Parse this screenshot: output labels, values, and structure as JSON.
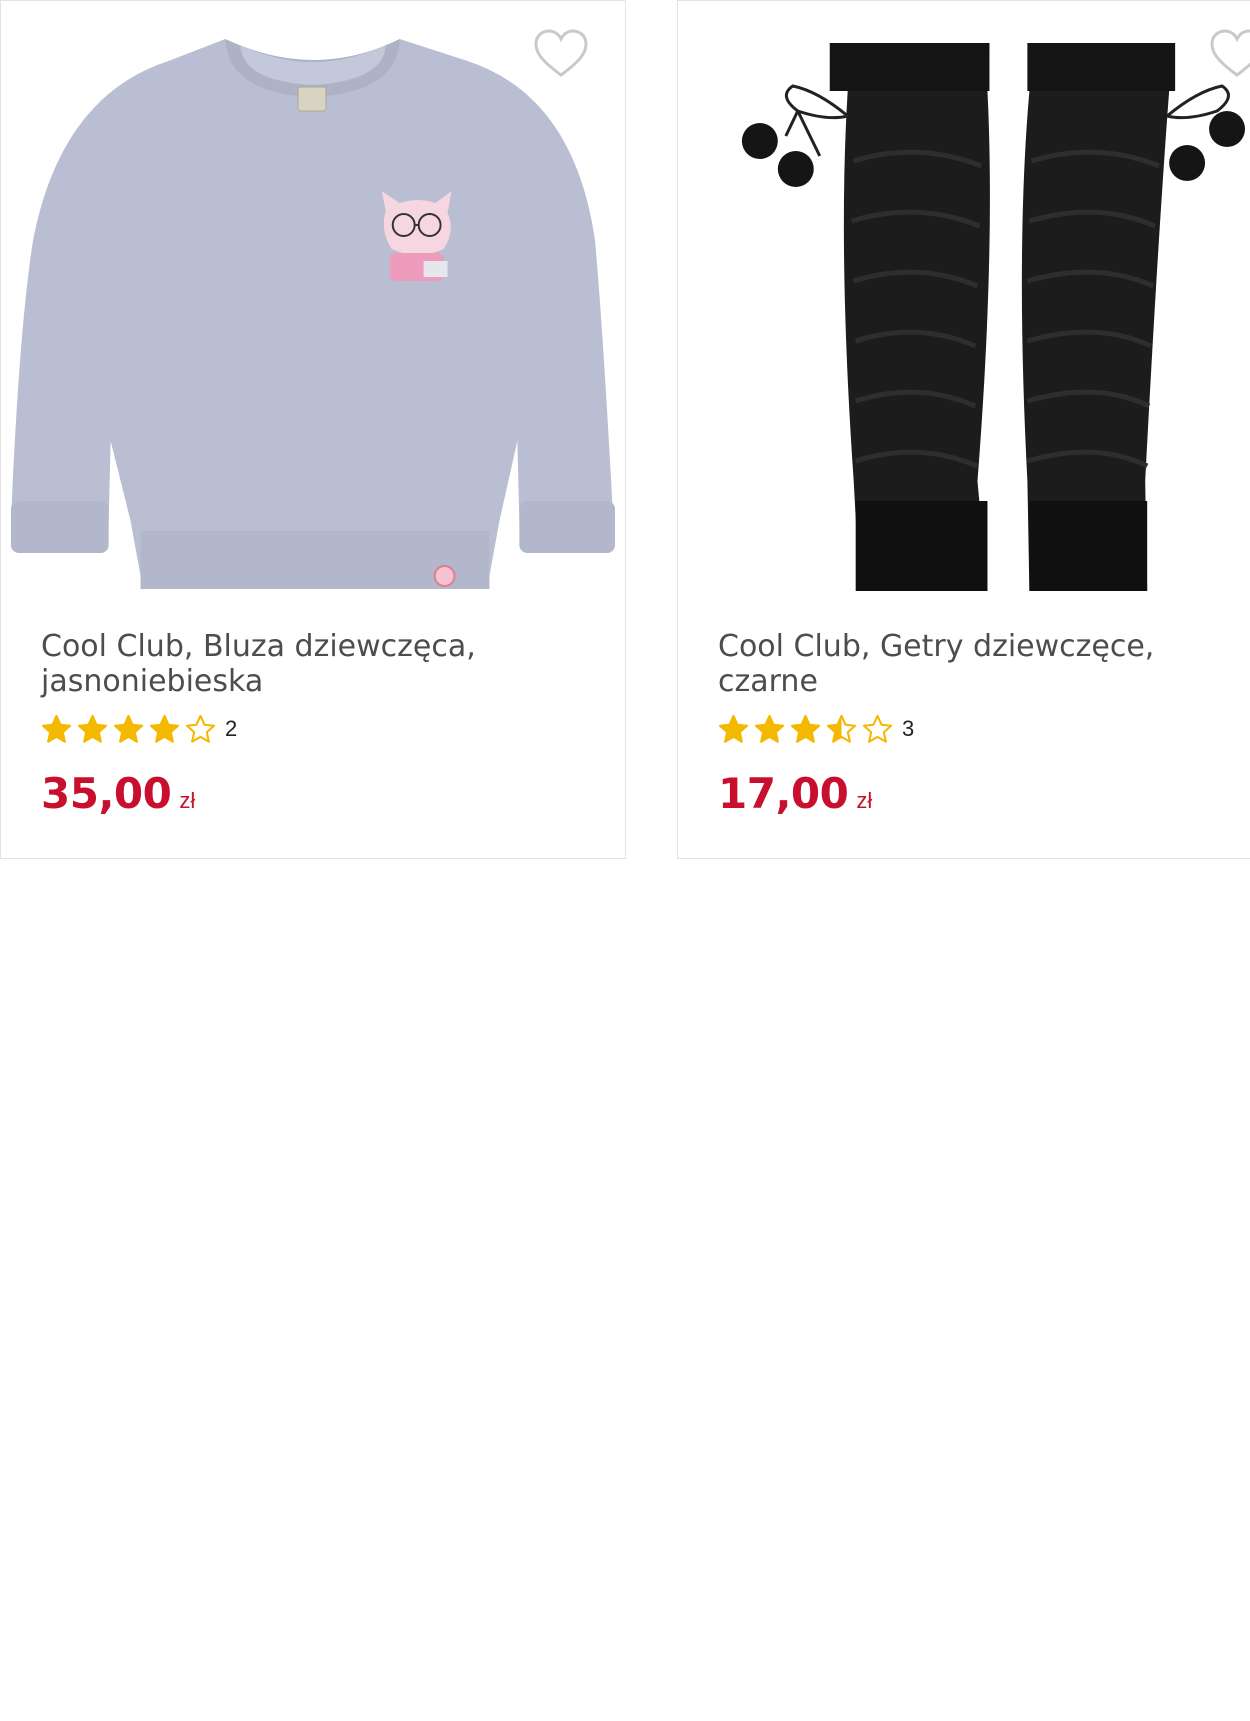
{
  "products": [
    {
      "name": "Cool Club, Bluza dziewczęca, jasnoniebieska",
      "rating": 4,
      "rating_count": "2",
      "price": "35,00",
      "currency": "zł",
      "image": "light-blue-sweatshirt-with-cat-print"
    },
    {
      "name": "Cool Club, Getry dziewczęce, czarne",
      "rating": 3.5,
      "rating_count": "3",
      "price": "17,00",
      "currency": "zł",
      "image": "black-knit-leg-warmers-with-pompoms"
    }
  ],
  "colors": {
    "price": "#c8102e",
    "star": "#f5b800",
    "title": "#4d4d4d",
    "border": "#e3e3e3"
  }
}
